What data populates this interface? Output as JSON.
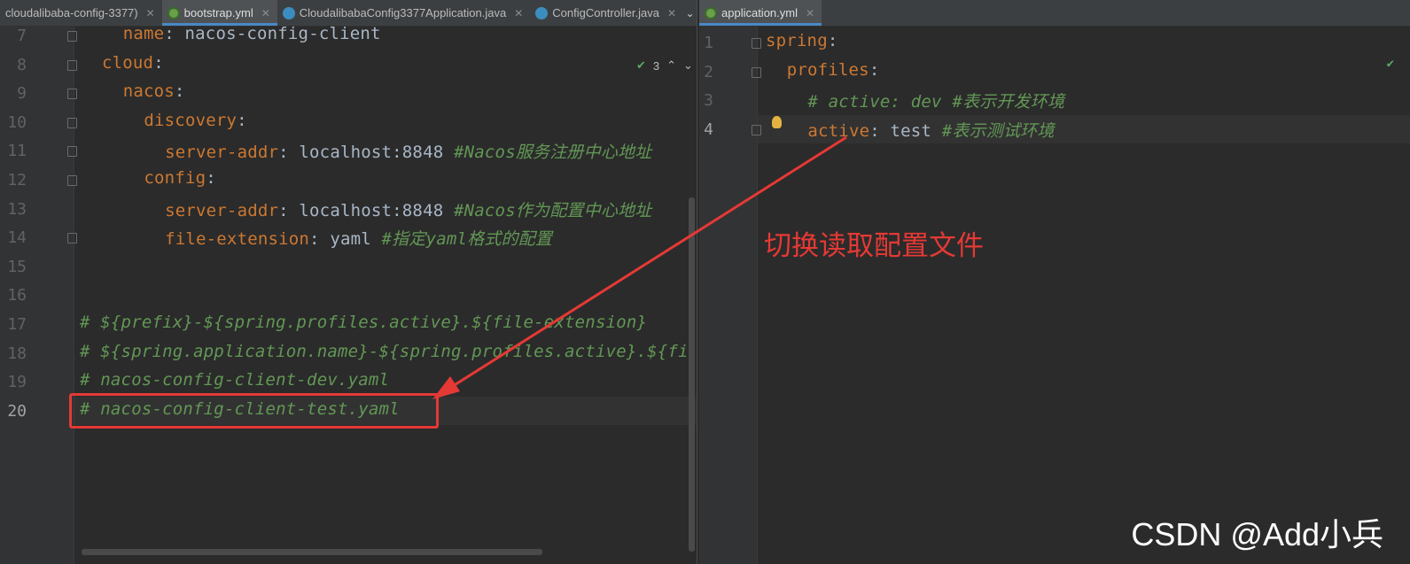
{
  "left_tabs": [
    {
      "label": "cloudalibaba-config-3377)",
      "icon": "module-icon",
      "active": false
    },
    {
      "label": "bootstrap.yml",
      "icon": "yaml-file-icon",
      "active": true
    },
    {
      "label": "CloudalibabaConfig3377Application.java",
      "icon": "java-class-icon",
      "active": false
    },
    {
      "label": "ConfigController.java",
      "icon": "java-class-icon",
      "active": false
    }
  ],
  "right_tabs": [
    {
      "label": "application.yml",
      "icon": "yaml-file-icon",
      "active": true
    }
  ],
  "left_editor": {
    "inspection_count": "3",
    "lines": [
      {
        "num": "7",
        "indent": 1,
        "key": "name",
        "value": " nacos-config-client",
        "comment": ""
      },
      {
        "num": "8",
        "indent": 0,
        "key": "cloud",
        "value": "",
        "comment": ""
      },
      {
        "num": "9",
        "indent": 1,
        "key": "nacos",
        "value": "",
        "comment": ""
      },
      {
        "num": "10",
        "indent": 2,
        "key": "discovery",
        "value": "",
        "comment": ""
      },
      {
        "num": "11",
        "indent": 3,
        "key": "server-addr",
        "value": " localhost:8848 ",
        "comment": "#Nacos服务注册中心地址"
      },
      {
        "num": "12",
        "indent": 2,
        "key": "config",
        "value": "",
        "comment": ""
      },
      {
        "num": "13",
        "indent": 3,
        "key": "server-addr",
        "value": " localhost:8848 ",
        "comment": "#Nacos作为配置中心地址"
      },
      {
        "num": "14",
        "indent": 3,
        "key": "file-extension",
        "value": " yaml ",
        "comment": "#指定yaml格式的配置"
      },
      {
        "num": "15",
        "indent": 0,
        "key": "",
        "value": "",
        "comment": ""
      },
      {
        "num": "16",
        "indent": 0,
        "key": "",
        "value": "",
        "comment": ""
      },
      {
        "num": "17",
        "indent": -1,
        "key": "",
        "value": "",
        "comment": "# ${prefix}-${spring.profiles.active}.${file-extension}"
      },
      {
        "num": "18",
        "indent": -1,
        "key": "",
        "value": "",
        "comment": "# ${spring.application.name}-${spring.profiles.active}.${fi"
      },
      {
        "num": "19",
        "indent": -1,
        "key": "",
        "value": "",
        "comment": "# nacos-config-client-dev.yaml"
      },
      {
        "num": "20",
        "indent": -1,
        "key": "",
        "value": "",
        "comment": "# nacos-config-client-test.yaml"
      }
    ]
  },
  "right_editor": {
    "lines": [
      {
        "num": "1",
        "indent": 0,
        "key": "spring",
        "value": "",
        "comment": ""
      },
      {
        "num": "2",
        "indent": 1,
        "key": "profiles",
        "value": "",
        "comment": ""
      },
      {
        "num": "3",
        "indent": 2,
        "key": "",
        "value": "",
        "comment": "# active: dev #表示开发环境"
      },
      {
        "num": "4",
        "indent": 2,
        "key": "active",
        "value": " test ",
        "comment": "#表示测试环境"
      }
    ]
  },
  "annotation": "切换读取配置文件",
  "watermark": "CSDN @Add小兵",
  "colors": {
    "annotation": "#e53935",
    "key": "#cc7832",
    "comment": "#629755",
    "text": "#a9b7c6"
  }
}
